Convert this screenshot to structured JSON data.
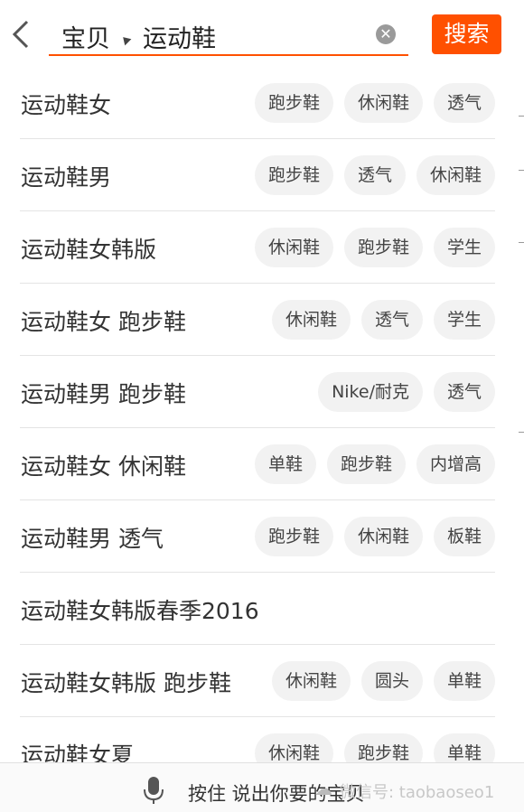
{
  "header": {
    "scope_label": "宝贝",
    "query": "运动鞋",
    "clear_glyph": "✕",
    "search_button": "搜索",
    "accent_color": "#ff5000"
  },
  "suggestions": [
    {
      "keyword": "运动鞋女",
      "tags": [
        "跑步鞋",
        "休闲鞋",
        "透气"
      ]
    },
    {
      "keyword": "运动鞋男",
      "tags": [
        "跑步鞋",
        "透气",
        "休闲鞋"
      ]
    },
    {
      "keyword": "运动鞋女韩版",
      "tags": [
        "休闲鞋",
        "跑步鞋",
        "学生"
      ]
    },
    {
      "keyword": "运动鞋女 跑步鞋",
      "tags": [
        "休闲鞋",
        "透气",
        "学生"
      ]
    },
    {
      "keyword": "运动鞋男 跑步鞋",
      "tags": [
        "Nike/耐克",
        "透气"
      ]
    },
    {
      "keyword": "运动鞋女 休闲鞋",
      "tags": [
        "单鞋",
        "跑步鞋",
        "内增高"
      ]
    },
    {
      "keyword": "运动鞋男 透气",
      "tags": [
        "跑步鞋",
        "休闲鞋",
        "板鞋"
      ]
    },
    {
      "keyword": "运动鞋女韩版春季2016",
      "tags": []
    },
    {
      "keyword": "运动鞋女韩版 跑步鞋",
      "tags": [
        "休闲鞋",
        "圆头",
        "单鞋"
      ]
    },
    {
      "keyword": "运动鞋女夏",
      "tags": [
        "休闲鞋",
        "跑步鞋",
        "单鞋"
      ]
    }
  ],
  "footer": {
    "voice_hint": "按住 说出你要的宝贝",
    "watermark": "微信号: taobaoseo1"
  },
  "icons": [
    "back-arrow-icon",
    "dropdown-triangle-icon",
    "clear-icon",
    "microphone-icon",
    "wechat-icon"
  ]
}
